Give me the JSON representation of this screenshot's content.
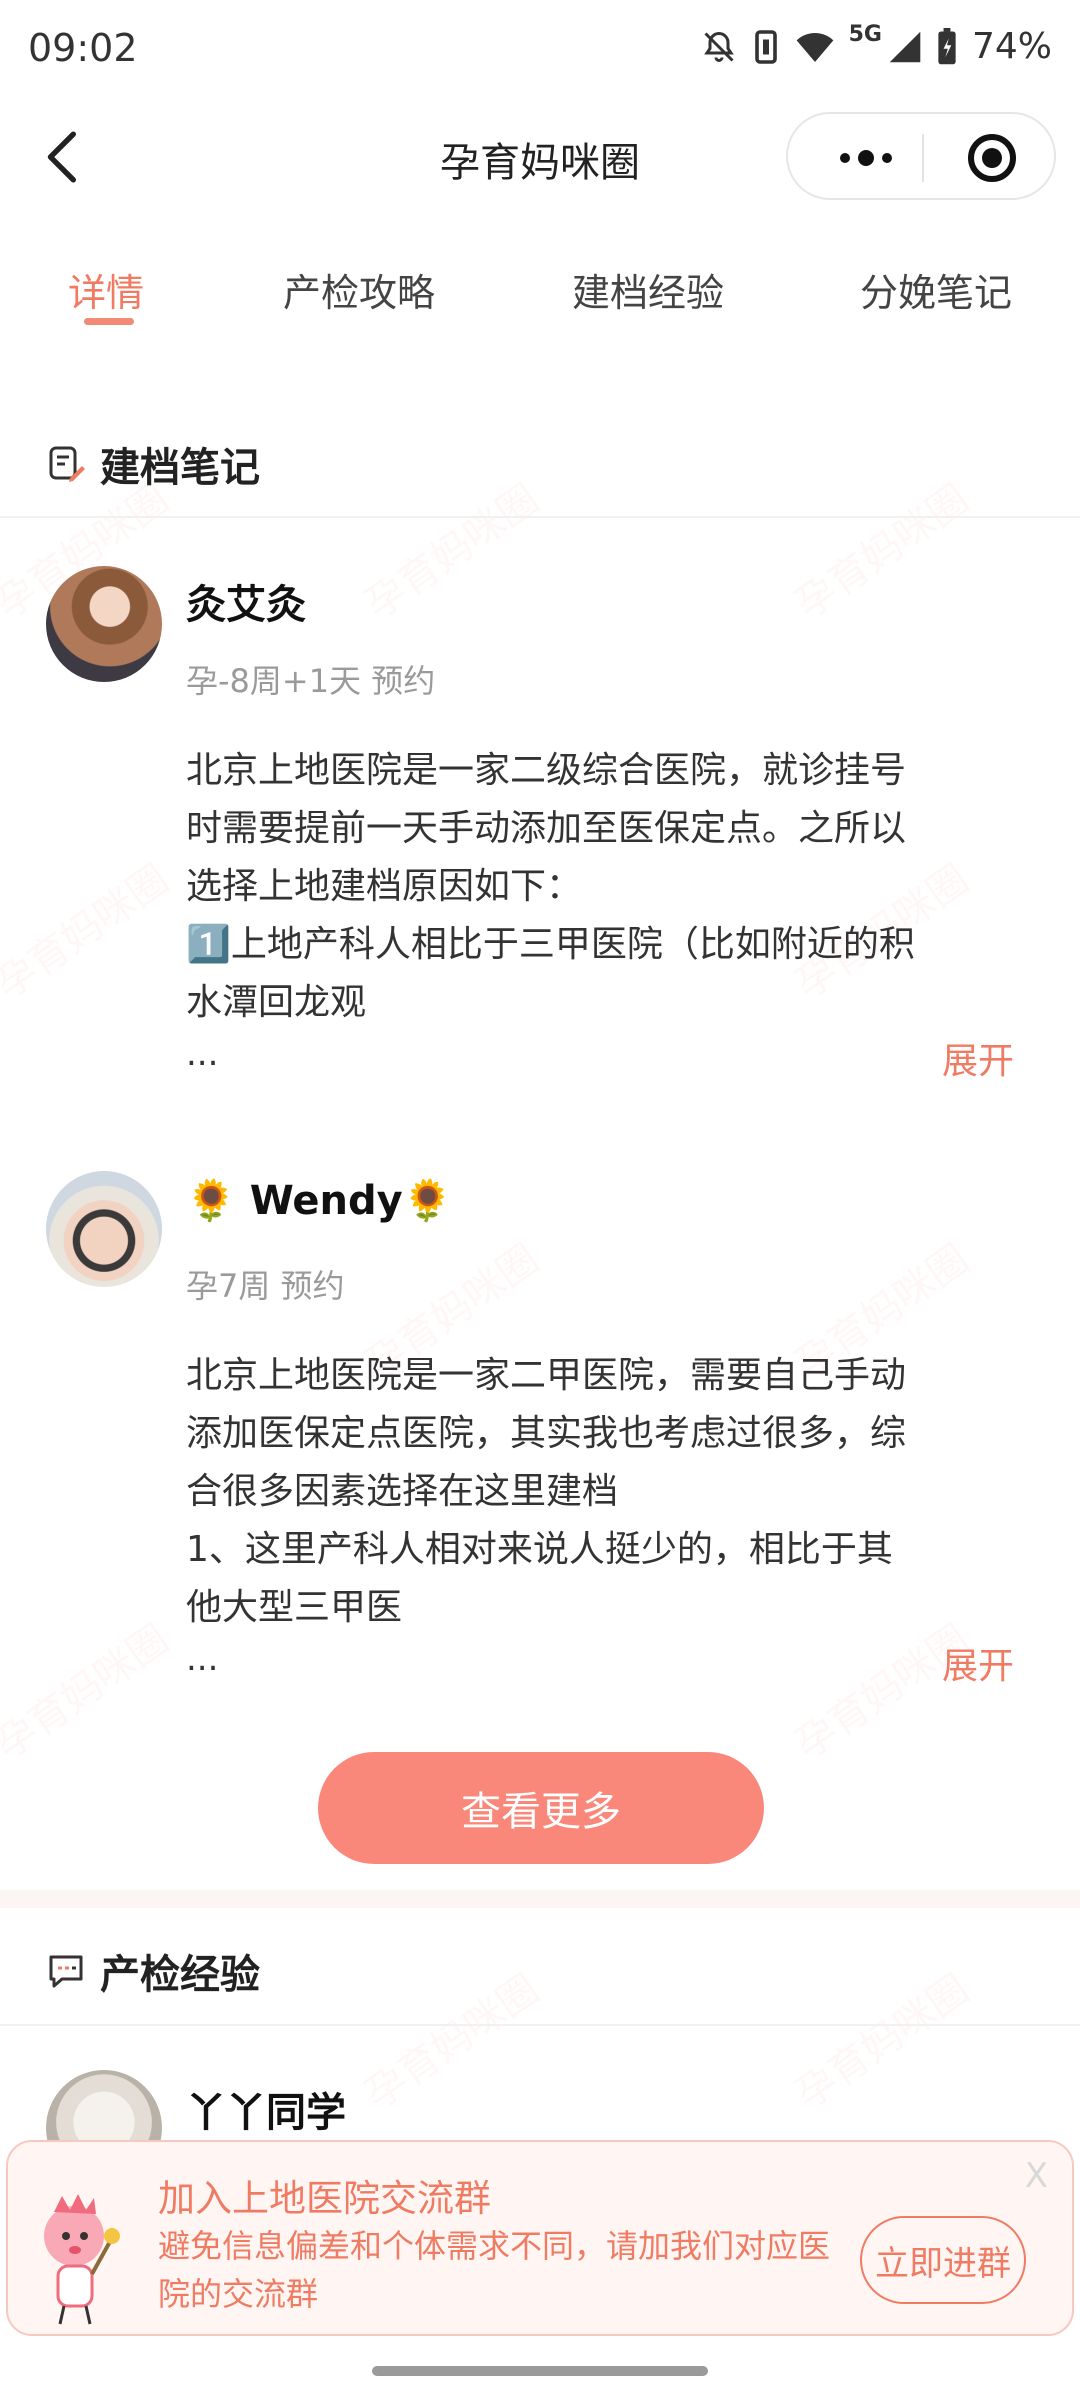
{
  "status_bar": {
    "time": "09:02",
    "network": "5G",
    "battery": "74%"
  },
  "header": {
    "title": "孕育妈咪圈"
  },
  "tabs": [
    {
      "label": "详情",
      "active": true
    },
    {
      "label": "产检攻略",
      "active": false
    },
    {
      "label": "建档经验",
      "active": false
    },
    {
      "label": "分娩笔记",
      "active": false
    }
  ],
  "watermark": "孕育妈咪圈",
  "section_notes": {
    "title": "建档笔记",
    "posts": [
      {
        "username": "灸艾灸",
        "meta": "孕-8周+1天 预约",
        "text": "北京上地医院是一家二级综合医院，就诊挂号时需要提前一天手动添加至医保定点。之所以选择上地建档原因如下：\n1️⃣上地产科人相比于三甲医院（比如附近的积水潭回龙观",
        "ellipsis": "...",
        "expand": "展开"
      },
      {
        "username": "🌻 Wendy🌻",
        "meta": "孕7周 预约",
        "text": "北京上地医院是一家二甲医院，需要自己手动添加医保定点医院，其实我也考虑过很多，综合很多因素选择在这里建档\n1、这里产科人相对来说人挺少的，相比于其他大型三甲医",
        "ellipsis": "...",
        "expand": "展开"
      }
    ],
    "more_button": "查看更多"
  },
  "section_checkup": {
    "title": "产检经验",
    "posts": [
      {
        "username": "丫丫同学"
      }
    ]
  },
  "banner": {
    "title": "加入上地医院交流群",
    "description": "避免信息偏差和个体需求不同，请加我们对应医院的交流群",
    "button": "立即进群",
    "close": "X"
  },
  "colors": {
    "accent": "#f07b63",
    "button_bg": "#f9887a"
  }
}
